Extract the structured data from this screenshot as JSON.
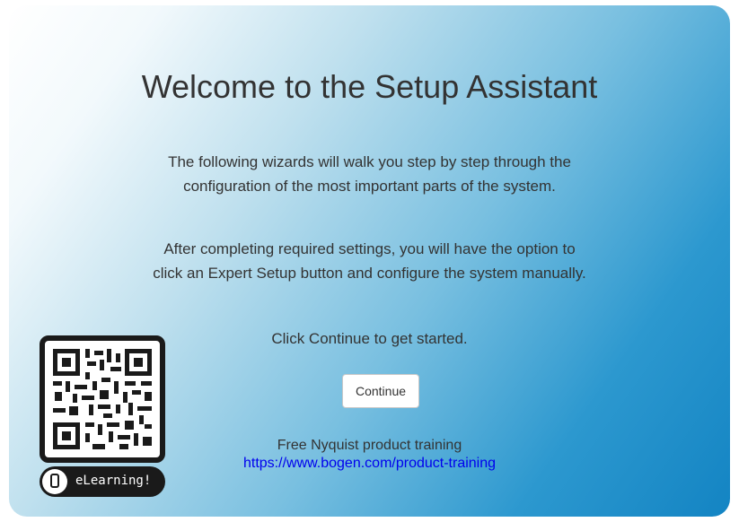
{
  "wizard": {
    "title": "Welcome to the Setup Assistant",
    "intro_line1": "The following wizards will walk you step by step through the",
    "intro_line2": "configuration of the most important parts of the system.",
    "expert_line1": "After completing required settings, you will have the option to",
    "expert_line2": "click an Expert Setup button and configure the system manually.",
    "prompt": "Click Continue to get started.",
    "continue_label": "Continue",
    "training_text": "Free Nyquist product training",
    "training_url": "https://www.bogen.com/product-training"
  },
  "badge": {
    "qr_icon": "qr-code",
    "label": "eLearning!",
    "icon": "phone-icon"
  },
  "colors": {
    "gradient_start": "#ffffff",
    "gradient_end": "#1384c3",
    "text": "#333333",
    "link": "#0000ee"
  }
}
